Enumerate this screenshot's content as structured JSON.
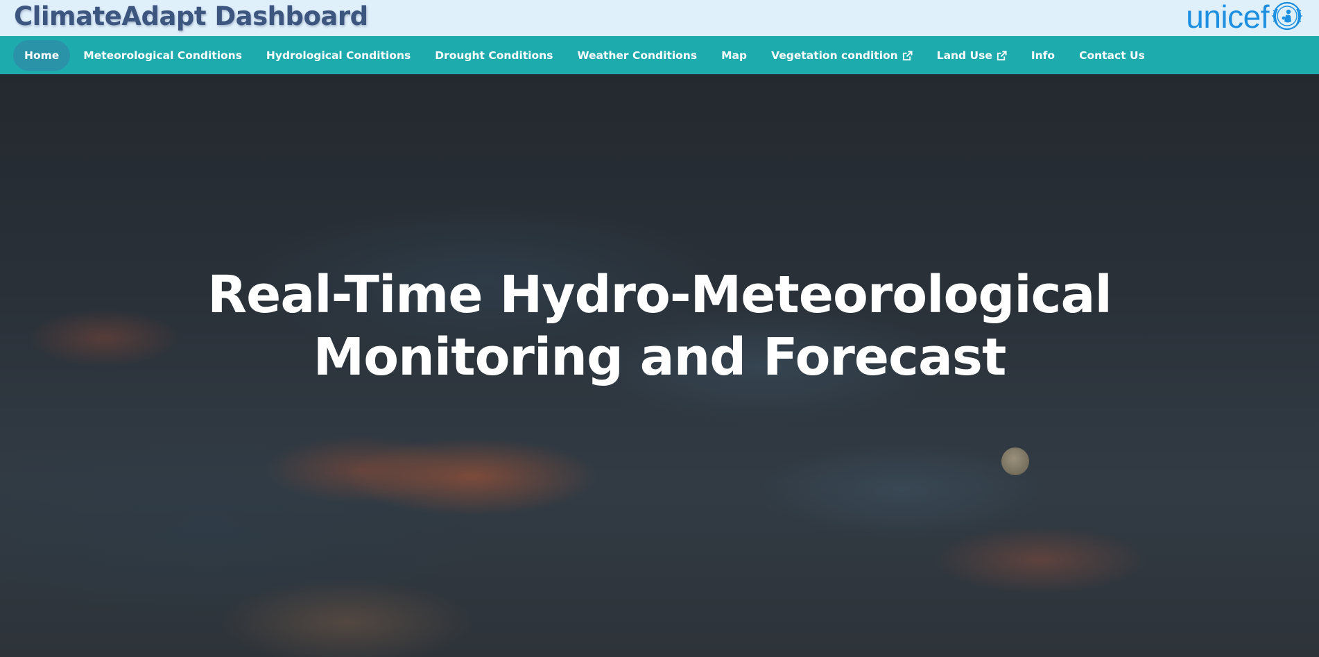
{
  "header": {
    "title": "ClimateAdapt Dashboard",
    "logo_text": "unicef",
    "logo_color": "#1d8fe0"
  },
  "nav": {
    "items": [
      {
        "label": "Home",
        "active": true
      },
      {
        "label": "Meteorological Conditions"
      },
      {
        "label": "Hydrological Conditions"
      },
      {
        "label": "Drought Conditions"
      },
      {
        "label": "Weather Conditions"
      },
      {
        "label": "Map"
      },
      {
        "label": "Vegetation condition",
        "icon": "external-link-icon"
      },
      {
        "label": "Land Use",
        "icon": "external-link-icon"
      },
      {
        "label": "Info"
      },
      {
        "label": "Contact Us"
      }
    ],
    "background_color": "#1eabad"
  },
  "hero": {
    "title_line1": "Real-Time Hydro-Meteorological",
    "title_line2": "Monitoring and Forecast"
  }
}
